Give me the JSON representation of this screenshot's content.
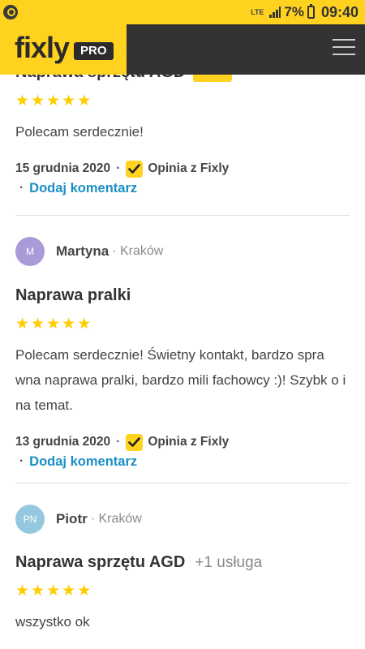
{
  "status_bar": {
    "network": "LTE",
    "battery_percent": "7%",
    "time": "09:40"
  },
  "header": {
    "logo": "fixly",
    "badge": "PRO"
  },
  "reviews": [
    {
      "title": "Naprawa sprzętu AGD",
      "rating": 5,
      "text": "Polecam serdecznie!",
      "date": "15 grudnia 2020",
      "verified_label": "Opinia z Fixly",
      "comment_link": "Dodaj komentarz"
    },
    {
      "author": {
        "initials": "M",
        "name": "Martyna",
        "city": "· Kraków",
        "avatar_color": "#a99bd8"
      },
      "title": "Naprawa pralki",
      "rating": 5,
      "text": "Polecam serdecznie! Świetny kontakt, bardzo spra wna naprawa pralki, bardzo mili fachowcy :)! Szybk o i na temat.",
      "date": "13 grudnia 2020",
      "verified_label": "Opinia z Fixly",
      "comment_link": "Dodaj komentarz"
    },
    {
      "author": {
        "initials": "PN",
        "name": "Piotr",
        "city": "· Kraków",
        "avatar_color": "#94c8df"
      },
      "title": "Naprawa sprzętu AGD",
      "extra_services": "+1 usługa",
      "rating": 5,
      "text": "wszystko ok"
    }
  ],
  "colors": {
    "brand_yellow": "#ffd21f",
    "header_dark": "#333333",
    "link_blue": "#1b8fc4",
    "star": "#ffcc00"
  }
}
